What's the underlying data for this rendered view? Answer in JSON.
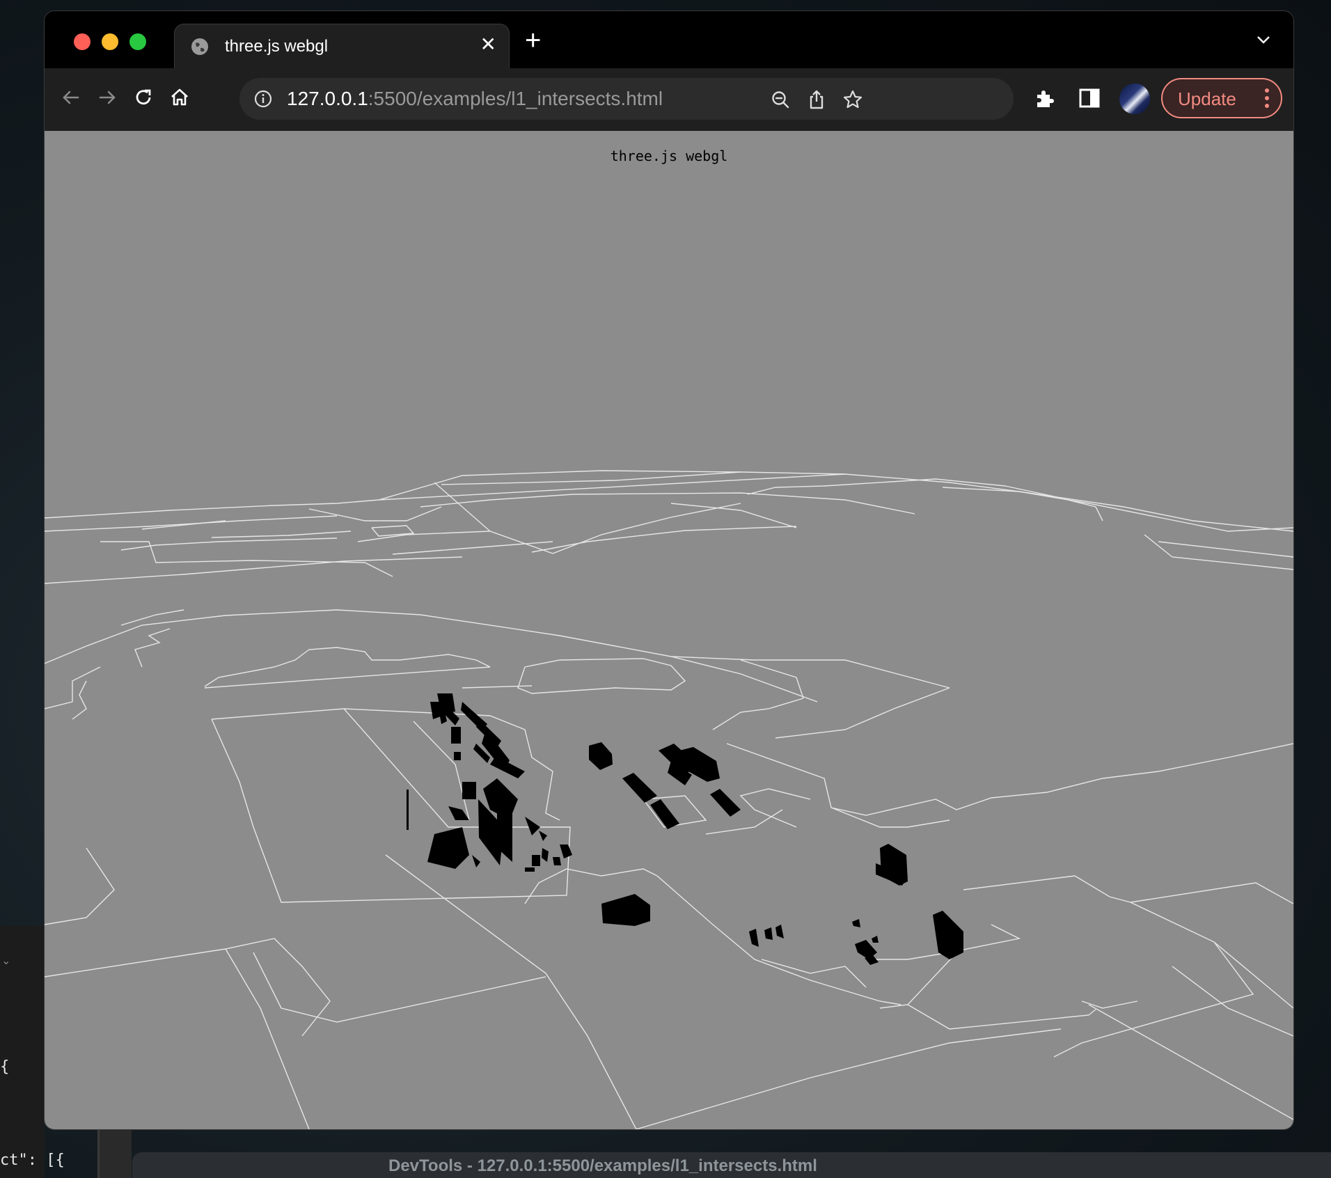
{
  "browser": {
    "tab_title": "three.js webgl",
    "url_host": "127.0.0.1",
    "url_rest": ":5500/examples/l1_intersects.html",
    "update_label": "Update"
  },
  "page": {
    "info": "three.js webgl"
  },
  "desktop": {
    "code_line_1": "{",
    "code_line_2": "ct\": [{",
    "devtools_title": "DevTools - 127.0.0.1:5500/examples/l1_intersects.html"
  },
  "colors": {
    "viewport_bg": "#8c8c8c",
    "update_accent": "#f28b82"
  },
  "icons": [
    "globe-icon",
    "close-icon",
    "plus-icon",
    "chevron-down-icon",
    "back-icon",
    "forward-icon",
    "reload-icon",
    "home-icon",
    "info-icon",
    "zoom-out-icon",
    "share-icon",
    "star-icon",
    "puzzle-icon",
    "side-panel-icon",
    "avatar",
    "kebab-icon"
  ]
}
